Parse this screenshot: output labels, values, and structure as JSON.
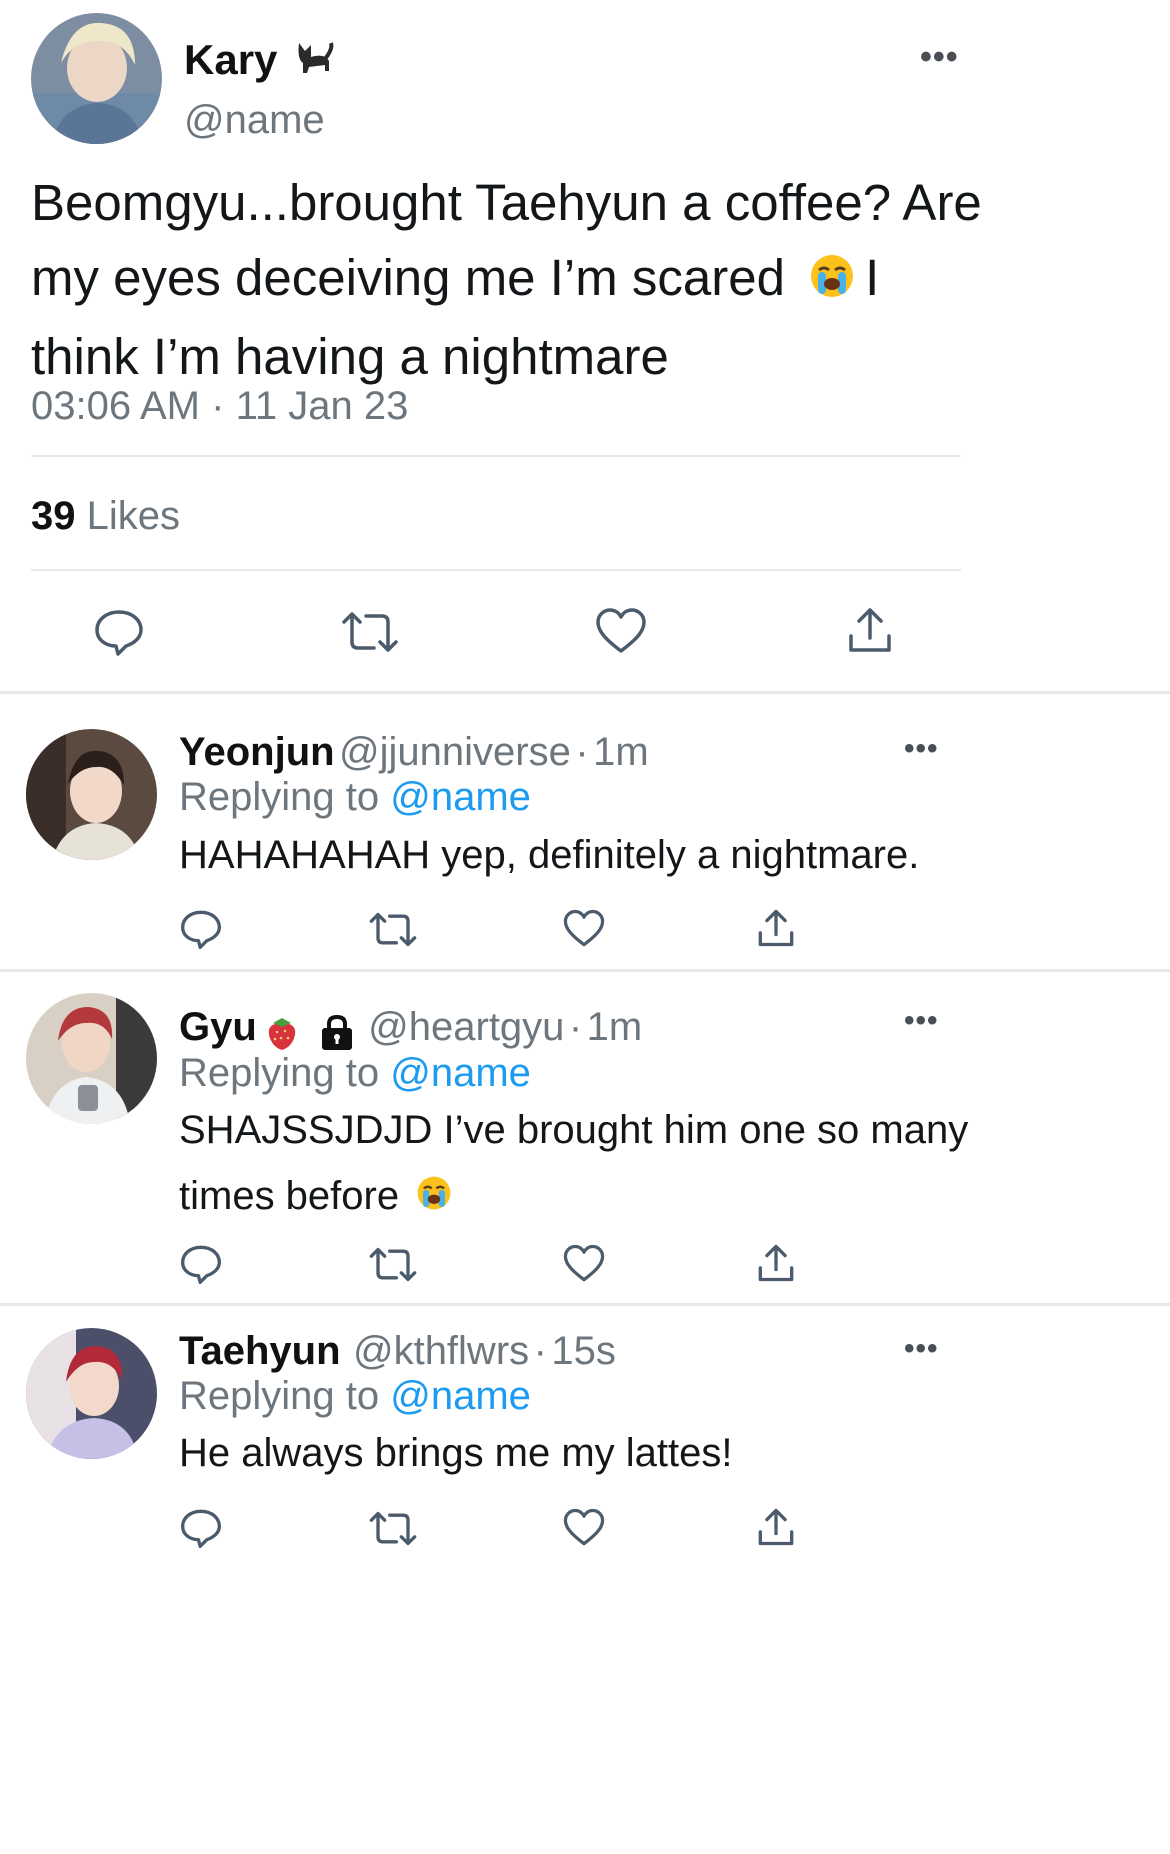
{
  "main_tweet": {
    "author_name": "Kary",
    "author_emoji": "🐈‍⬛",
    "handle": "@name",
    "text_line1": "Beomgyu...brought Taehyun a coffee? Are",
    "text_line2a": "my eyes deceiving me I’m scared",
    "text_line2b": "I",
    "text_line3": "think I’m having a nightmare",
    "time": "03:06 AM",
    "date_sep": "·",
    "date": "11 Jan 23",
    "likes_count": "39",
    "likes_label": "Likes"
  },
  "replies": [
    {
      "name": "Yeonjun",
      "handle": "@jjunniverse",
      "sep": "·",
      "time": "1m",
      "replying_label": "Replying to",
      "replying_to": "@name",
      "text_line1": "HAHAHAHAH yep, definitely a nightmare."
    },
    {
      "name": "Gyu",
      "handle": "@heartgyu",
      "sep": "·",
      "time": "1m",
      "replying_label": "Replying to",
      "replying_to": "@name",
      "text_line1": "SHAJSSJDJD I’ve brought him one so many",
      "text_line2": "times before"
    },
    {
      "name": "Taehyun",
      "handle": "@kthflwrs",
      "sep": "·",
      "time": "15s",
      "replying_label": "Replying to",
      "replying_to": "@name",
      "text_line1": "He always brings me my lattes!"
    }
  ],
  "more_label": "•••",
  "colors": {
    "accent": "#1d9bf0",
    "secondary_text": "#6e767d",
    "icon": "#4b5b6b"
  },
  "icons": [
    "reply-icon",
    "retweet-icon",
    "like-icon",
    "share-icon",
    "more-icon",
    "lock-icon",
    "strawberry-icon",
    "crying-face-icon",
    "cat-icon"
  ]
}
